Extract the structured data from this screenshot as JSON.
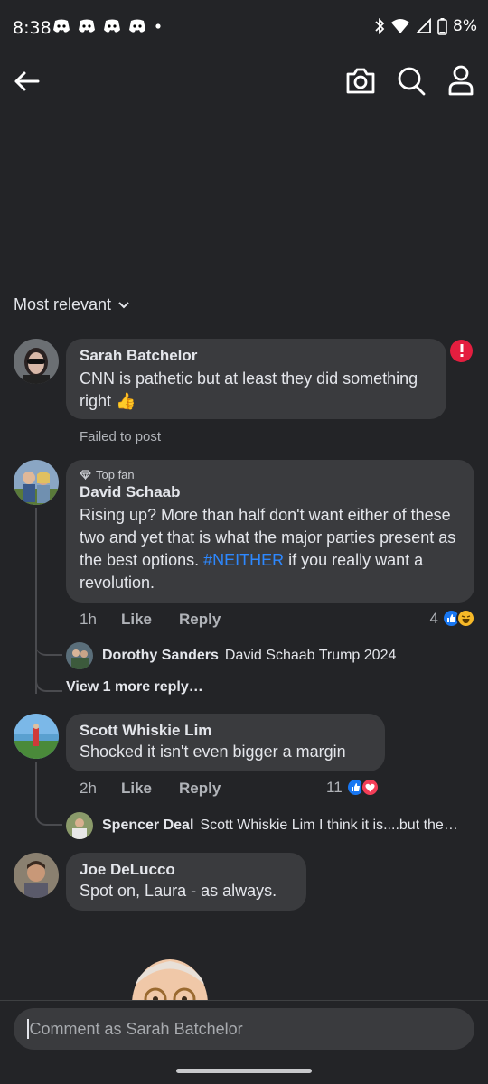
{
  "status_bar": {
    "time": "8:38",
    "battery": "8%"
  },
  "sort": {
    "label": "Most relevant"
  },
  "comments": [
    {
      "name": "Sarah Batchelor",
      "text": "CNN is pathetic but at least they did something right 👍",
      "status": "Failed to post"
    },
    {
      "badge": "Top fan",
      "name": "David Schaab",
      "text_before": "Rising up? More than half don't want either of these two and yet that is what the major parties present as the best options. ",
      "hashtag": "#NEITHER",
      "text_after": " if you really want a revolution.",
      "time": "1h",
      "like": "Like",
      "reply": "Reply",
      "reaction_count": "4",
      "reply_preview": {
        "name": "Dorothy Sanders",
        "text": "David Schaab Trump 2024"
      },
      "view_more": "View 1 more reply…"
    },
    {
      "name": "Scott Whiskie Lim",
      "text": "Shocked it isn't even bigger a margin",
      "time": "2h",
      "like": "Like",
      "reply": "Reply",
      "reaction_count": "11",
      "reply_preview": {
        "name": "Spencer Deal",
        "text": "Scott Whiskie Lim I think it is....but the…"
      }
    },
    {
      "name": "Joe DeLucco",
      "text": "Spot on, Laura - as always."
    }
  ],
  "composer": {
    "placeholder": "Comment as Sarah Batchelor"
  },
  "colors": {
    "background": "#232427",
    "bubble": "#3a3b3e",
    "link": "#2d88ff",
    "error": "#e41e3f"
  }
}
